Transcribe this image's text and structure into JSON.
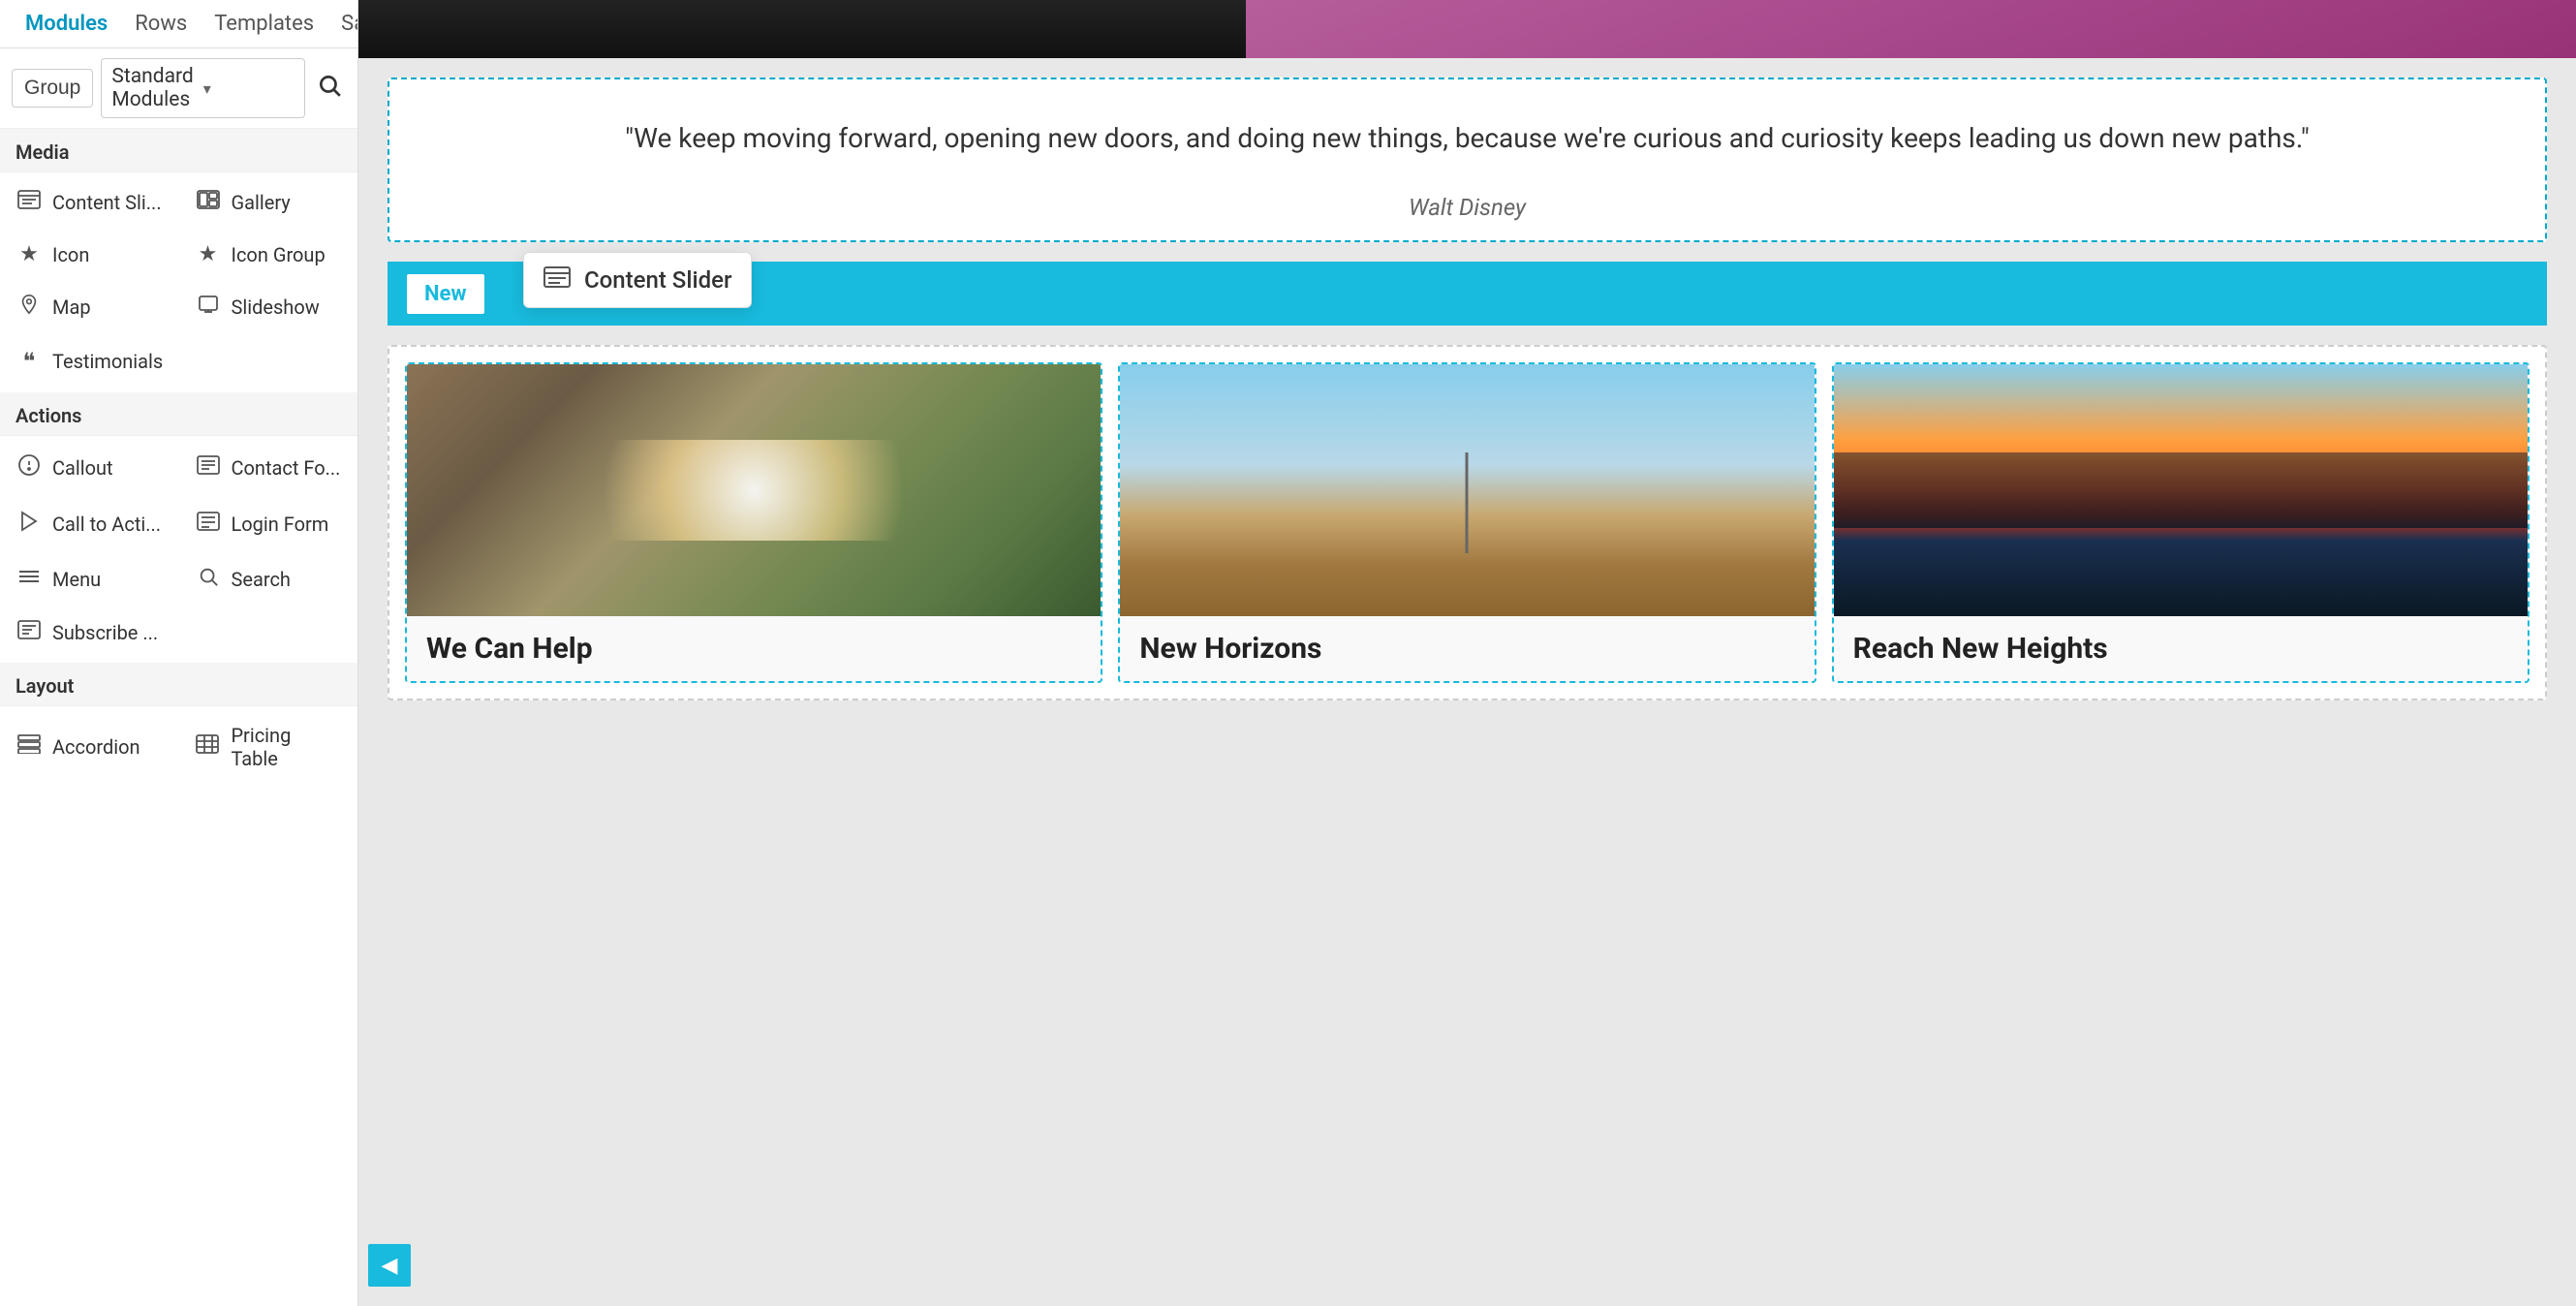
{
  "topNav": {
    "tabs": [
      {
        "id": "modules",
        "label": "Modules",
        "active": true
      },
      {
        "id": "rows",
        "label": "Rows",
        "active": false
      },
      {
        "id": "templates",
        "label": "Templates",
        "active": false
      },
      {
        "id": "saved",
        "label": "Saved",
        "active": false
      }
    ]
  },
  "toolbar": {
    "groupBtn": "Group",
    "dropdown": "Standard Modules",
    "searchPlaceholder": "Search"
  },
  "sidebar": {
    "sections": [
      {
        "id": "media",
        "label": "Media",
        "items": [
          {
            "id": "content-slider",
            "icon": "▤",
            "label": "Content Sli..."
          },
          {
            "id": "gallery",
            "icon": "⊡",
            "label": "Gallery"
          },
          {
            "id": "icon",
            "icon": "★",
            "label": "Icon"
          },
          {
            "id": "icon-group",
            "icon": "★",
            "label": "Icon Group"
          },
          {
            "id": "map",
            "icon": "◎",
            "label": "Map"
          },
          {
            "id": "slideshow",
            "icon": "▤",
            "label": "Slideshow"
          },
          {
            "id": "testimonials",
            "icon": "❝",
            "label": "Testimonials"
          }
        ]
      },
      {
        "id": "actions",
        "label": "Actions",
        "items": [
          {
            "id": "callout",
            "icon": "📣",
            "label": "Callout"
          },
          {
            "id": "contact-form",
            "icon": "▤",
            "label": "Contact Fo..."
          },
          {
            "id": "call-to-action",
            "icon": "📣",
            "label": "Call to Acti..."
          },
          {
            "id": "login-form",
            "icon": "▤",
            "label": "Login Form"
          },
          {
            "id": "menu",
            "icon": "≡",
            "label": "Menu"
          },
          {
            "id": "search",
            "icon": "🔍",
            "label": "Search"
          },
          {
            "id": "subscribe",
            "icon": "▤",
            "label": "Subscribe ..."
          }
        ]
      },
      {
        "id": "layout",
        "label": "Layout",
        "items": [
          {
            "id": "accordion",
            "icon": "▤",
            "label": "Accordion"
          },
          {
            "id": "pricing-table",
            "icon": "▤",
            "label": "Pricing Table"
          }
        ]
      }
    ]
  },
  "mainContent": {
    "quote": {
      "text": "\"We keep moving forward, opening new doors, and doing new things, because we're curious and curiosity keeps leading us down new paths.\"",
      "author": "Walt Disney"
    },
    "newBanner": {
      "label": "New",
      "tooltip": {
        "icon": "▤",
        "label": "Content Slider"
      }
    },
    "gallery": {
      "cards": [
        {
          "id": "flowers",
          "caption": "We Can Help",
          "imgClass": "img-flowers"
        },
        {
          "id": "windmill",
          "caption": "New Horizons",
          "imgClass": "img-windmill"
        },
        {
          "id": "sunset",
          "caption": "Reach New Heights",
          "imgClass": "img-sunset"
        }
      ]
    }
  },
  "icons": {
    "search": "🔍",
    "chevronDown": "▾",
    "colResize": "⋮",
    "navBack": "◀"
  }
}
